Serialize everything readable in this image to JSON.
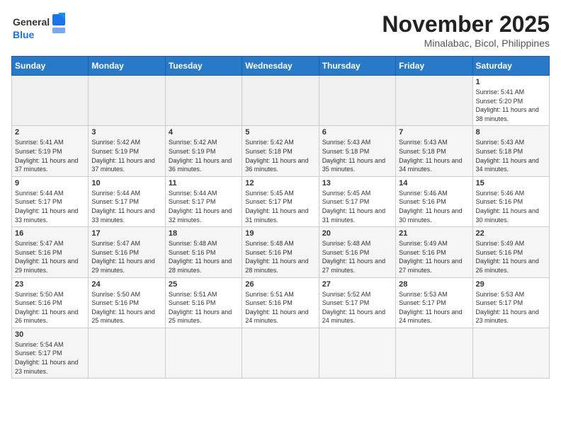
{
  "header": {
    "logo_general": "General",
    "logo_blue": "Blue",
    "month": "November 2025",
    "location": "Minalabac, Bicol, Philippines"
  },
  "days_of_week": [
    "Sunday",
    "Monday",
    "Tuesday",
    "Wednesday",
    "Thursday",
    "Friday",
    "Saturday"
  ],
  "weeks": [
    [
      {
        "day": "",
        "sunrise": "",
        "sunset": "",
        "daylight": ""
      },
      {
        "day": "",
        "sunrise": "",
        "sunset": "",
        "daylight": ""
      },
      {
        "day": "",
        "sunrise": "",
        "sunset": "",
        "daylight": ""
      },
      {
        "day": "",
        "sunrise": "",
        "sunset": "",
        "daylight": ""
      },
      {
        "day": "",
        "sunrise": "",
        "sunset": "",
        "daylight": ""
      },
      {
        "day": "",
        "sunrise": "",
        "sunset": "",
        "daylight": ""
      },
      {
        "day": "1",
        "sunrise": "Sunrise: 5:41 AM",
        "sunset": "Sunset: 5:20 PM",
        "daylight": "Daylight: 11 hours and 38 minutes."
      }
    ],
    [
      {
        "day": "2",
        "sunrise": "Sunrise: 5:41 AM",
        "sunset": "Sunset: 5:19 PM",
        "daylight": "Daylight: 11 hours and 37 minutes."
      },
      {
        "day": "3",
        "sunrise": "Sunrise: 5:42 AM",
        "sunset": "Sunset: 5:19 PM",
        "daylight": "Daylight: 11 hours and 37 minutes."
      },
      {
        "day": "4",
        "sunrise": "Sunrise: 5:42 AM",
        "sunset": "Sunset: 5:19 PM",
        "daylight": "Daylight: 11 hours and 36 minutes."
      },
      {
        "day": "5",
        "sunrise": "Sunrise: 5:42 AM",
        "sunset": "Sunset: 5:18 PM",
        "daylight": "Daylight: 11 hours and 36 minutes."
      },
      {
        "day": "6",
        "sunrise": "Sunrise: 5:43 AM",
        "sunset": "Sunset: 5:18 PM",
        "daylight": "Daylight: 11 hours and 35 minutes."
      },
      {
        "day": "7",
        "sunrise": "Sunrise: 5:43 AM",
        "sunset": "Sunset: 5:18 PM",
        "daylight": "Daylight: 11 hours and 34 minutes."
      },
      {
        "day": "8",
        "sunrise": "Sunrise: 5:43 AM",
        "sunset": "Sunset: 5:18 PM",
        "daylight": "Daylight: 11 hours and 34 minutes."
      }
    ],
    [
      {
        "day": "9",
        "sunrise": "Sunrise: 5:44 AM",
        "sunset": "Sunset: 5:17 PM",
        "daylight": "Daylight: 11 hours and 33 minutes."
      },
      {
        "day": "10",
        "sunrise": "Sunrise: 5:44 AM",
        "sunset": "Sunset: 5:17 PM",
        "daylight": "Daylight: 11 hours and 33 minutes."
      },
      {
        "day": "11",
        "sunrise": "Sunrise: 5:44 AM",
        "sunset": "Sunset: 5:17 PM",
        "daylight": "Daylight: 11 hours and 32 minutes."
      },
      {
        "day": "12",
        "sunrise": "Sunrise: 5:45 AM",
        "sunset": "Sunset: 5:17 PM",
        "daylight": "Daylight: 11 hours and 31 minutes."
      },
      {
        "day": "13",
        "sunrise": "Sunrise: 5:45 AM",
        "sunset": "Sunset: 5:17 PM",
        "daylight": "Daylight: 11 hours and 31 minutes."
      },
      {
        "day": "14",
        "sunrise": "Sunrise: 5:46 AM",
        "sunset": "Sunset: 5:16 PM",
        "daylight": "Daylight: 11 hours and 30 minutes."
      },
      {
        "day": "15",
        "sunrise": "Sunrise: 5:46 AM",
        "sunset": "Sunset: 5:16 PM",
        "daylight": "Daylight: 11 hours and 30 minutes."
      }
    ],
    [
      {
        "day": "16",
        "sunrise": "Sunrise: 5:47 AM",
        "sunset": "Sunset: 5:16 PM",
        "daylight": "Daylight: 11 hours and 29 minutes."
      },
      {
        "day": "17",
        "sunrise": "Sunrise: 5:47 AM",
        "sunset": "Sunset: 5:16 PM",
        "daylight": "Daylight: 11 hours and 29 minutes."
      },
      {
        "day": "18",
        "sunrise": "Sunrise: 5:48 AM",
        "sunset": "Sunset: 5:16 PM",
        "daylight": "Daylight: 11 hours and 28 minutes."
      },
      {
        "day": "19",
        "sunrise": "Sunrise: 5:48 AM",
        "sunset": "Sunset: 5:16 PM",
        "daylight": "Daylight: 11 hours and 28 minutes."
      },
      {
        "day": "20",
        "sunrise": "Sunrise: 5:48 AM",
        "sunset": "Sunset: 5:16 PM",
        "daylight": "Daylight: 11 hours and 27 minutes."
      },
      {
        "day": "21",
        "sunrise": "Sunrise: 5:49 AM",
        "sunset": "Sunset: 5:16 PM",
        "daylight": "Daylight: 11 hours and 27 minutes."
      },
      {
        "day": "22",
        "sunrise": "Sunrise: 5:49 AM",
        "sunset": "Sunset: 5:16 PM",
        "daylight": "Daylight: 11 hours and 26 minutes."
      }
    ],
    [
      {
        "day": "23",
        "sunrise": "Sunrise: 5:50 AM",
        "sunset": "Sunset: 5:16 PM",
        "daylight": "Daylight: 11 hours and 26 minutes."
      },
      {
        "day": "24",
        "sunrise": "Sunrise: 5:50 AM",
        "sunset": "Sunset: 5:16 PM",
        "daylight": "Daylight: 11 hours and 25 minutes."
      },
      {
        "day": "25",
        "sunrise": "Sunrise: 5:51 AM",
        "sunset": "Sunset: 5:16 PM",
        "daylight": "Daylight: 11 hours and 25 minutes."
      },
      {
        "day": "26",
        "sunrise": "Sunrise: 5:51 AM",
        "sunset": "Sunset: 5:16 PM",
        "daylight": "Daylight: 11 hours and 24 minutes."
      },
      {
        "day": "27",
        "sunrise": "Sunrise: 5:52 AM",
        "sunset": "Sunset: 5:17 PM",
        "daylight": "Daylight: 11 hours and 24 minutes."
      },
      {
        "day": "28",
        "sunrise": "Sunrise: 5:53 AM",
        "sunset": "Sunset: 5:17 PM",
        "daylight": "Daylight: 11 hours and 24 minutes."
      },
      {
        "day": "29",
        "sunrise": "Sunrise: 5:53 AM",
        "sunset": "Sunset: 5:17 PM",
        "daylight": "Daylight: 11 hours and 23 minutes."
      }
    ],
    [
      {
        "day": "30",
        "sunrise": "Sunrise: 5:54 AM",
        "sunset": "Sunset: 5:17 PM",
        "daylight": "Daylight: 11 hours and 23 minutes."
      },
      {
        "day": "",
        "sunrise": "",
        "sunset": "",
        "daylight": ""
      },
      {
        "day": "",
        "sunrise": "",
        "sunset": "",
        "daylight": ""
      },
      {
        "day": "",
        "sunrise": "",
        "sunset": "",
        "daylight": ""
      },
      {
        "day": "",
        "sunrise": "",
        "sunset": "",
        "daylight": ""
      },
      {
        "day": "",
        "sunrise": "",
        "sunset": "",
        "daylight": ""
      },
      {
        "day": "",
        "sunrise": "",
        "sunset": "",
        "daylight": ""
      }
    ]
  ]
}
